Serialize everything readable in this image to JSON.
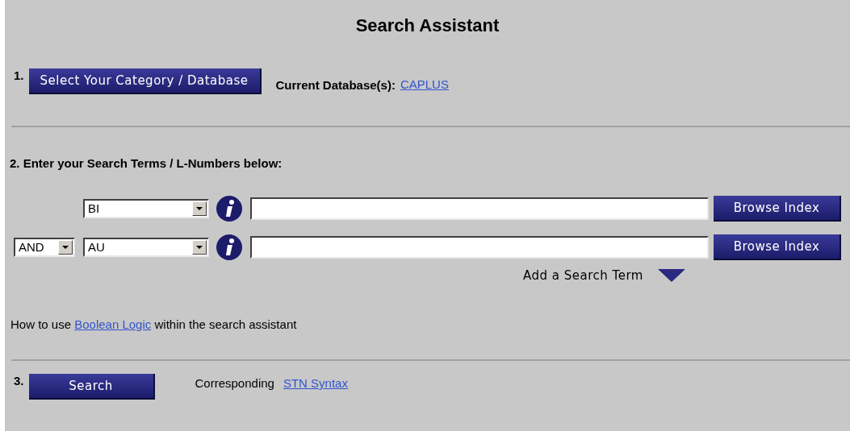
{
  "title": "Search Assistant",
  "step1": {
    "number": "1.",
    "button": "Select Your Category / Database",
    "db_label": "Current Database(s):",
    "db_link": "CAPLUS"
  },
  "step2": {
    "heading": "2. Enter your Search Terms / L-Numbers below:",
    "rows": [
      {
        "field": "BI",
        "browse": "Browse Index"
      },
      {
        "operator": "AND",
        "field": "AU",
        "browse": "Browse Index"
      }
    ],
    "add_term": "Add a Search Term",
    "help": {
      "before": "How to use",
      "link": "Boolean Logic",
      "after": "within the search assistant"
    }
  },
  "step3": {
    "number": "3.",
    "button": "Search",
    "label": "Corresponding",
    "link": "STN Syntax"
  }
}
